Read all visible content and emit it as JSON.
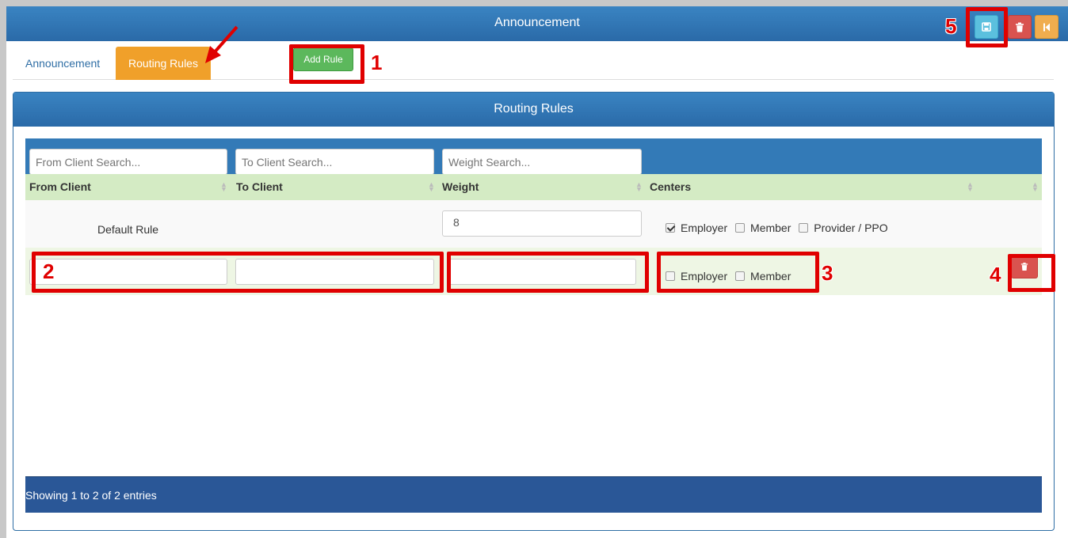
{
  "window": {
    "title": "Announcement"
  },
  "toolbar": {
    "save_icon": "save-icon",
    "delete_icon": "trash-icon",
    "back_icon": "skip-back-icon"
  },
  "tabs": [
    {
      "label": "Announcement",
      "active": false
    },
    {
      "label": "Routing Rules",
      "active": true
    }
  ],
  "add_rule_label": "Add Rule",
  "panel": {
    "title": "Routing Rules"
  },
  "search": {
    "from_placeholder": "From Client Search...",
    "to_placeholder": "To Client Search...",
    "weight_placeholder": "Weight Search..."
  },
  "table": {
    "headers": [
      "From Client",
      "To Client",
      "Weight",
      "Centers"
    ],
    "rows": [
      {
        "from_client": "Default Rule",
        "to_client": "",
        "weight": "8",
        "centers": [
          {
            "label": "Employer",
            "checked": true
          },
          {
            "label": "Member",
            "checked": false
          },
          {
            "label": "Provider / PPO",
            "checked": false
          }
        ]
      },
      {
        "from_client": "",
        "to_client": "",
        "weight": "",
        "centers": [
          {
            "label": "Employer",
            "checked": false
          },
          {
            "label": "Member",
            "checked": false
          }
        ]
      }
    ]
  },
  "footer": {
    "info": "Showing 1 to 2 of 2 entries"
  },
  "callouts": [
    "1",
    "2",
    "3",
    "4",
    "5"
  ],
  "colors": {
    "header_blue": "#2a6aa8",
    "tab_active": "#f0a02a",
    "add_green": "#5cb85c",
    "save_cyan": "#5bc0de",
    "delete_red": "#d9534f",
    "back_orange": "#f0ad4e",
    "annotation_red": "#e00000"
  }
}
